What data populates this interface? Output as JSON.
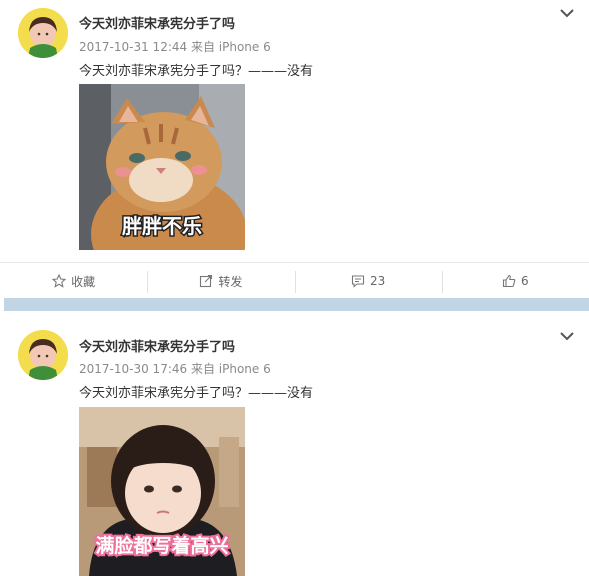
{
  "posts": [
    {
      "user": "今天刘亦菲宋承宪分手了吗",
      "date": "2017-10-31 12:44",
      "source": "来自 iPhone 6",
      "text": "今天刘亦菲宋承宪分手了吗？———没有",
      "image_caption": "胖胖不乐",
      "actions": {
        "favorite": "收藏",
        "repost": "转发",
        "comments": "23",
        "likes": "6"
      }
    },
    {
      "user": "今天刘亦菲宋承宪分手了吗",
      "date": "2017-10-30 17:46",
      "source": "来自 iPhone 6",
      "text": "今天刘亦菲宋承宪分手了吗？———没有",
      "image_caption": "满脸都写着高兴"
    }
  ],
  "colors": {
    "divider": "#c2d5e5",
    "caption_pink": "#ee6f9a"
  },
  "icons": [
    "chevron-down-icon",
    "star-icon",
    "repost-icon",
    "comment-icon",
    "like-icon"
  ]
}
